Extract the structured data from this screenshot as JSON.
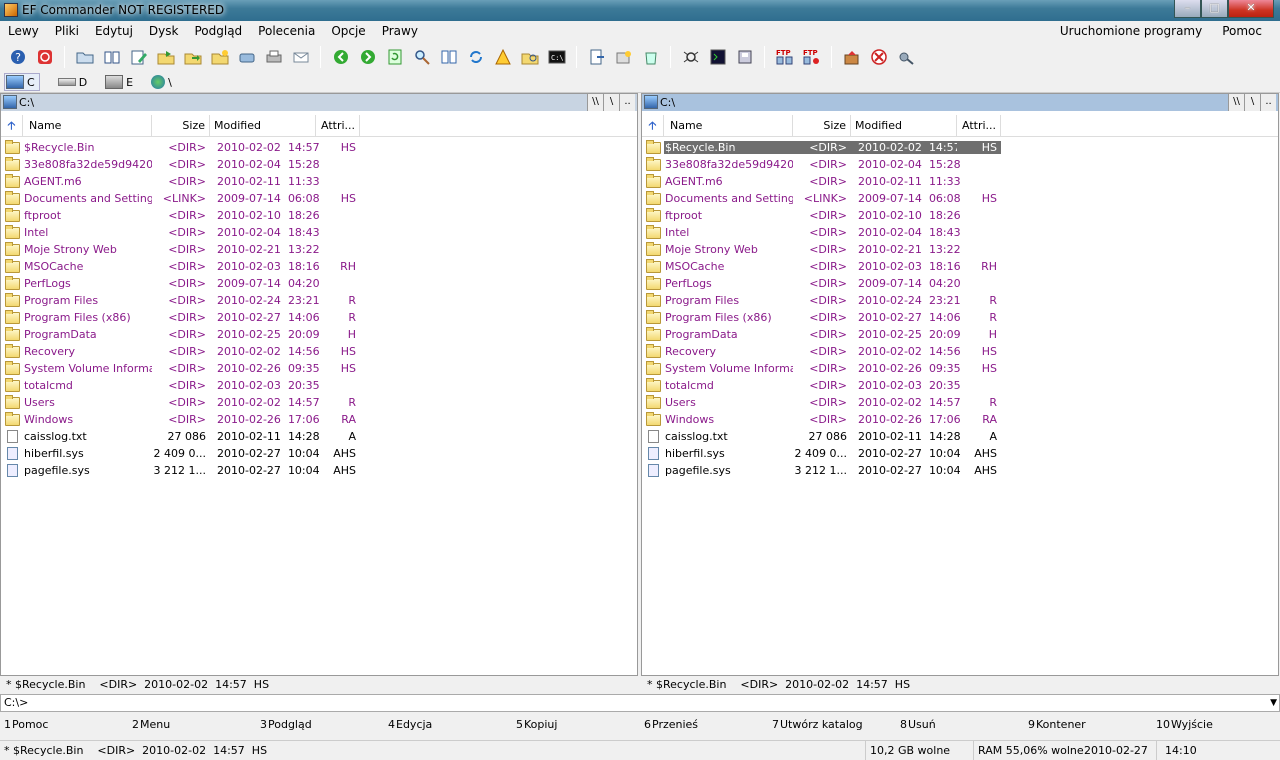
{
  "window": {
    "title": "EF Commander NOT REGISTERED",
    "min": "–",
    "max": "□",
    "close": "✕"
  },
  "menu": {
    "items": [
      "Lewy",
      "Pliki",
      "Edytuj",
      "Dysk",
      "Podgląd",
      "Polecenia",
      "Opcje",
      "Prawy"
    ],
    "right": [
      "Uruchomione programy",
      "Pomoc"
    ]
  },
  "toolbar": {
    "icons": [
      "help-icon",
      "power-icon",
      "folder-open-icon",
      "book-icon",
      "edit-icon",
      "copy-icon",
      "move-icon",
      "new-folder-icon",
      "drive-icon",
      "print-icon",
      "mail-icon",
      "back-icon",
      "forward-icon",
      "refresh-icon",
      "search-icon",
      "compare-icon",
      "sync-icon",
      "warning-icon",
      "find-folder-icon",
      "console-icon",
      "exit-doc-icon",
      "pack-icon",
      "recycle-icon",
      "bug-icon",
      "terminal-icon",
      "disk-tool-icon",
      "ftp-connect-icon",
      "ftp-disconnect-icon",
      "install-icon",
      "cancel-icon",
      "tools-icon"
    ]
  },
  "drives": [
    {
      "label": "C"
    },
    {
      "label": "D"
    },
    {
      "label": "E"
    },
    {
      "label": "\\"
    }
  ],
  "left": {
    "path": "C:\\",
    "status": "* $Recycle.Bin    <DIR>  2010-02-02  14:57  HS"
  },
  "right": {
    "path": "C:\\",
    "status": "* $Recycle.Bin    <DIR>  2010-02-02  14:57  HS"
  },
  "path_buttons": [
    "\\\\",
    "\\",
    ".."
  ],
  "columns": {
    "name": "Name",
    "size": "Size",
    "modified": "Modified",
    "attr": "Attri..."
  },
  "files": [
    {
      "name": "$Recycle.Bin",
      "size": "<DIR>",
      "date": "2010-02-02",
      "time": "14:57",
      "attr": "HS",
      "type": "dir"
    },
    {
      "name": "33e808fa32de59d9420...",
      "size": "<DIR>",
      "date": "2010-02-04",
      "time": "15:28",
      "attr": "",
      "type": "dir"
    },
    {
      "name": "AGENT.m6",
      "size": "<DIR>",
      "date": "2010-02-11",
      "time": "11:33",
      "attr": "",
      "type": "dir"
    },
    {
      "name": "Documents and Settings",
      "size": "<LINK>",
      "date": "2009-07-14",
      "time": "06:08",
      "attr": "HS",
      "type": "dir"
    },
    {
      "name": "ftproot",
      "size": "<DIR>",
      "date": "2010-02-10",
      "time": "18:26",
      "attr": "",
      "type": "dir"
    },
    {
      "name": "Intel",
      "size": "<DIR>",
      "date": "2010-02-04",
      "time": "18:43",
      "attr": "",
      "type": "dir"
    },
    {
      "name": "Moje Strony Web",
      "size": "<DIR>",
      "date": "2010-02-21",
      "time": "13:22",
      "attr": "",
      "type": "dir"
    },
    {
      "name": "MSOCache",
      "size": "<DIR>",
      "date": "2010-02-03",
      "time": "18:16",
      "attr": "RH",
      "type": "dir"
    },
    {
      "name": "PerfLogs",
      "size": "<DIR>",
      "date": "2009-07-14",
      "time": "04:20",
      "attr": "",
      "type": "dir"
    },
    {
      "name": "Program Files",
      "size": "<DIR>",
      "date": "2010-02-24",
      "time": "23:21",
      "attr": "R",
      "type": "dir"
    },
    {
      "name": "Program Files (x86)",
      "size": "<DIR>",
      "date": "2010-02-27",
      "time": "14:06",
      "attr": "R",
      "type": "dir"
    },
    {
      "name": "ProgramData",
      "size": "<DIR>",
      "date": "2010-02-25",
      "time": "20:09",
      "attr": "H",
      "type": "dir"
    },
    {
      "name": "Recovery",
      "size": "<DIR>",
      "date": "2010-02-02",
      "time": "14:56",
      "attr": "HS",
      "type": "dir"
    },
    {
      "name": "System Volume Informa...",
      "size": "<DIR>",
      "date": "2010-02-26",
      "time": "09:35",
      "attr": "HS",
      "type": "dir"
    },
    {
      "name": "totalcmd",
      "size": "<DIR>",
      "date": "2010-02-03",
      "time": "20:35",
      "attr": "",
      "type": "dir"
    },
    {
      "name": "Users",
      "size": "<DIR>",
      "date": "2010-02-02",
      "time": "14:57",
      "attr": "R",
      "type": "dir"
    },
    {
      "name": "Windows",
      "size": "<DIR>",
      "date": "2010-02-26",
      "time": "17:06",
      "attr": "RA",
      "type": "dir"
    },
    {
      "name": "caisslog.txt",
      "size": "27 086",
      "date": "2010-02-11",
      "time": "14:28",
      "attr": "A",
      "type": "file"
    },
    {
      "name": "hiberfil.sys",
      "size": "2 409 0...",
      "date": "2010-02-27",
      "time": "10:04",
      "attr": "AHS",
      "type": "sys"
    },
    {
      "name": "pagefile.sys",
      "size": "3 212 1...",
      "date": "2010-02-27",
      "time": "10:04",
      "attr": "AHS",
      "type": "sys"
    }
  ],
  "cmdline": {
    "value": "C:\\>"
  },
  "fkeys": [
    {
      "n": "1",
      "label": "Pomoc"
    },
    {
      "n": "2",
      "label": "Menu"
    },
    {
      "n": "3",
      "label": "Podgląd"
    },
    {
      "n": "4",
      "label": "Edycja"
    },
    {
      "n": "5",
      "label": "Kopiuj"
    },
    {
      "n": "6",
      "label": "Przenieś"
    },
    {
      "n": "7",
      "label": "Utwórz katalog"
    },
    {
      "n": "8",
      "label": "Usuń"
    },
    {
      "n": "9",
      "label": "Kontener"
    },
    {
      "n": "10",
      "label": "Wyjście"
    }
  ],
  "statusbar": {
    "selection": "* $Recycle.Bin    <DIR>  2010-02-02  14:57  HS",
    "free": "10,2 GB wolne",
    "ram": "RAM 55,06% wolne",
    "date": "2010-02-27",
    "time": "14:10"
  }
}
